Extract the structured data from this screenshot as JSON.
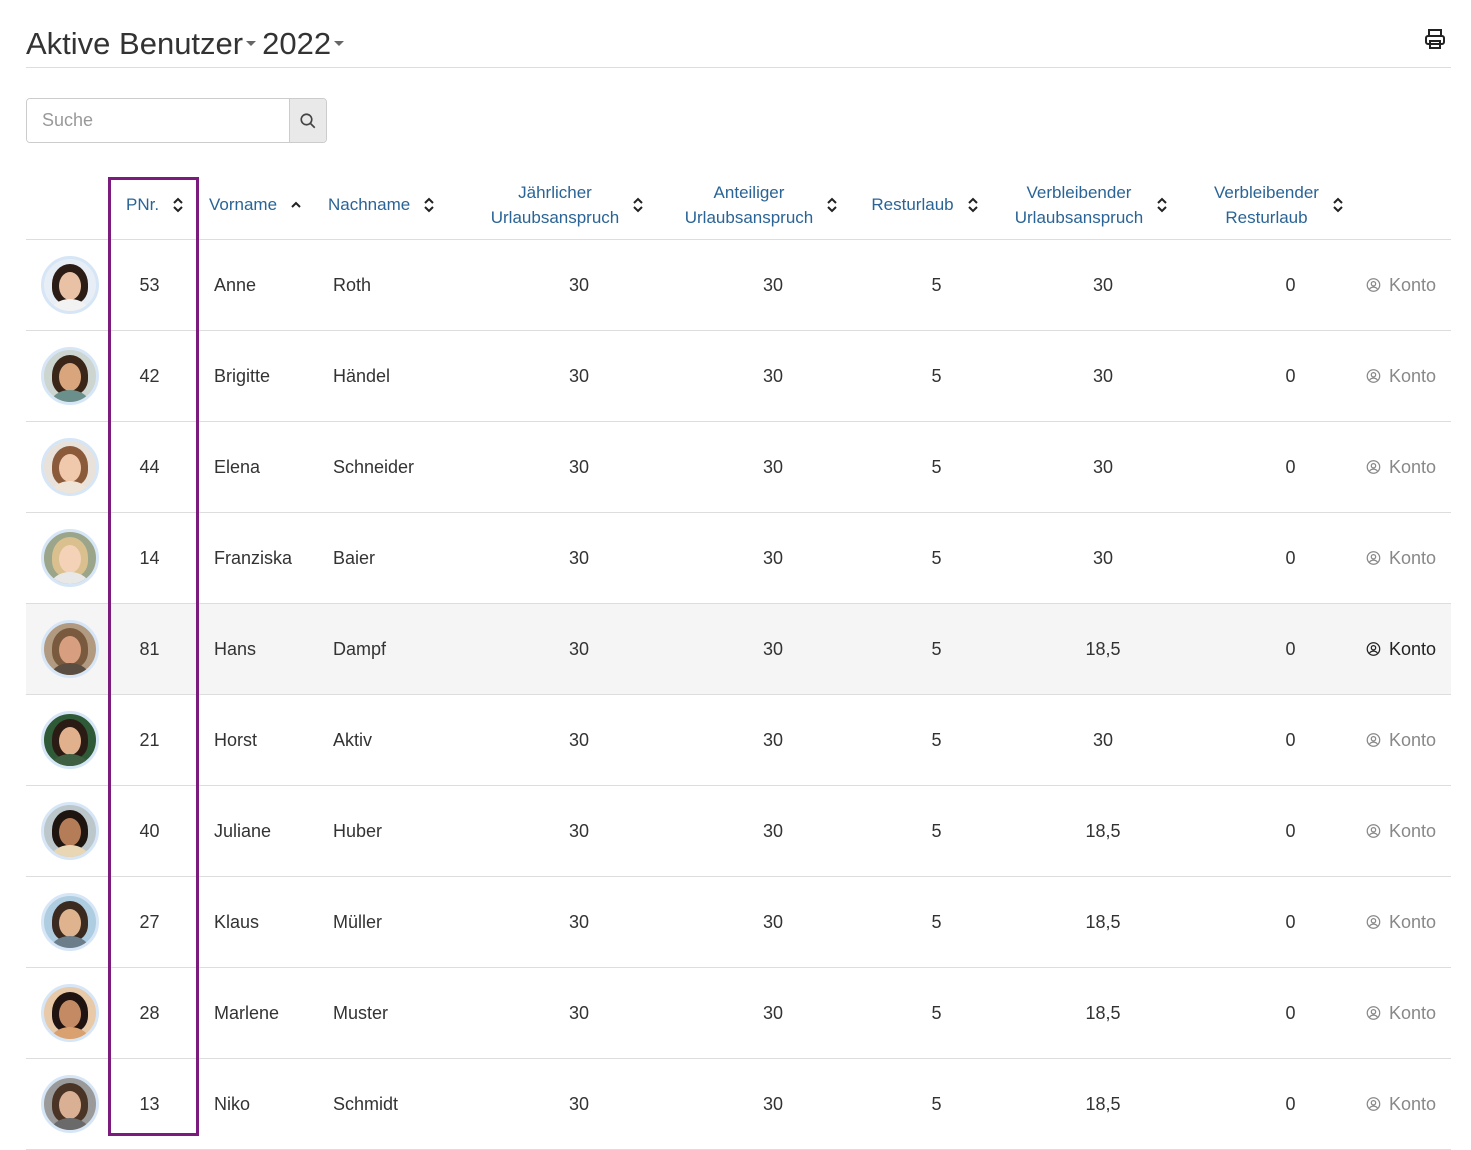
{
  "header": {
    "title_main": "Aktive Benutzer",
    "title_year": "2022",
    "print_icon": "printer-icon"
  },
  "search": {
    "placeholder": "Suche",
    "value": "",
    "icon": "search-icon"
  },
  "table": {
    "columns": [
      {
        "key": "pnr",
        "label": "PNr.",
        "sort": "both"
      },
      {
        "key": "vorname",
        "label": "Vorname",
        "sort": "asc"
      },
      {
        "key": "nachname",
        "label": "Nachname",
        "sort": "both"
      },
      {
        "key": "jaehrlich",
        "label_line1": "Jährlicher",
        "label_line2": "Urlaubsanspruch",
        "sort": "both"
      },
      {
        "key": "anteilig",
        "label_line1": "Anteiliger",
        "label_line2": "Urlaubsanspruch",
        "sort": "both"
      },
      {
        "key": "resturlaub",
        "label": "Resturlaub",
        "sort": "both"
      },
      {
        "key": "verbl_anspruch",
        "label_line1": "Verbleibender",
        "label_line2": "Urlaubsanspruch",
        "sort": "both"
      },
      {
        "key": "verbl_rest",
        "label_line1": "Verbleibender",
        "label_line2": "Resturlaub",
        "sort": "both"
      }
    ],
    "action_label": "Konto",
    "action_icon": "user-circle-icon",
    "rows": [
      {
        "pnr": "53",
        "vorname": "Anne",
        "nachname": "Roth",
        "jaehrlich": "30",
        "anteilig": "30",
        "resturlaub": "5",
        "verbl_anspruch": "30",
        "verbl_rest": "0",
        "konto": "Konto"
      },
      {
        "pnr": "42",
        "vorname": "Brigitte",
        "nachname": "Händel",
        "jaehrlich": "30",
        "anteilig": "30",
        "resturlaub": "5",
        "verbl_anspruch": "30",
        "verbl_rest": "0",
        "konto": "Konto"
      },
      {
        "pnr": "44",
        "vorname": "Elena",
        "nachname": "Schneider",
        "jaehrlich": "30",
        "anteilig": "30",
        "resturlaub": "5",
        "verbl_anspruch": "30",
        "verbl_rest": "0",
        "konto": "Konto"
      },
      {
        "pnr": "14",
        "vorname": "Franziska",
        "nachname": "Baier",
        "jaehrlich": "30",
        "anteilig": "30",
        "resturlaub": "5",
        "verbl_anspruch": "30",
        "verbl_rest": "0",
        "konto": "Konto"
      },
      {
        "pnr": "81",
        "vorname": "Hans",
        "nachname": "Dampf",
        "jaehrlich": "30",
        "anteilig": "30",
        "resturlaub": "5",
        "verbl_anspruch": "18,5",
        "verbl_rest": "0",
        "konto": "Konto"
      },
      {
        "pnr": "21",
        "vorname": "Horst",
        "nachname": "Aktiv",
        "jaehrlich": "30",
        "anteilig": "30",
        "resturlaub": "5",
        "verbl_anspruch": "30",
        "verbl_rest": "0",
        "konto": "Konto"
      },
      {
        "pnr": "40",
        "vorname": "Juliane",
        "nachname": "Huber",
        "jaehrlich": "30",
        "anteilig": "30",
        "resturlaub": "5",
        "verbl_anspruch": "18,5",
        "verbl_rest": "0",
        "konto": "Konto"
      },
      {
        "pnr": "27",
        "vorname": "Klaus",
        "nachname": "Müller",
        "jaehrlich": "30",
        "anteilig": "30",
        "resturlaub": "5",
        "verbl_anspruch": "18,5",
        "verbl_rest": "0",
        "konto": "Konto"
      },
      {
        "pnr": "28",
        "vorname": "Marlene",
        "nachname": "Muster",
        "jaehrlich": "30",
        "anteilig": "30",
        "resturlaub": "5",
        "verbl_anspruch": "18,5",
        "verbl_rest": "0",
        "konto": "Konto"
      },
      {
        "pnr": "13",
        "vorname": "Niko",
        "nachname": "Schmidt",
        "jaehrlich": "30",
        "anteilig": "30",
        "resturlaub": "5",
        "verbl_anspruch": "18,5",
        "verbl_rest": "0",
        "konto": "Konto"
      }
    ],
    "hovered_row_index": 4
  },
  "colors": {
    "header_link": "#2a6496",
    "highlight_box": "#7b1b7e",
    "hover_row": "#f5f5f5",
    "konto_inactive": "#888888",
    "konto_active": "#222222"
  },
  "avatars": [
    {
      "hair": "#2b1d16",
      "skin": "#e9c2a6",
      "shirt": "#f2f2f2",
      "bg": "#e7eef6"
    },
    {
      "hair": "#3a2618",
      "skin": "#d9a57d",
      "shirt": "#6b8f8a",
      "bg": "#cdd5d0"
    },
    {
      "hair": "#8a5a3a",
      "skin": "#f0c9ad",
      "shirt": "#efe4d8",
      "bg": "#e9e2da"
    },
    {
      "hair": "#d9c08e",
      "skin": "#f3d2b7",
      "shirt": "#e8e8e8",
      "bg": "#9aa58a"
    },
    {
      "hair": "#7a5a3e",
      "skin": "#d79f7f",
      "shirt": "#5a4d42",
      "bg": "#b19a80"
    },
    {
      "hair": "#2a1c15",
      "skin": "#e1b08c",
      "shirt": "#3f5f42",
      "bg": "#2f5a37"
    },
    {
      "hair": "#1e1410",
      "skin": "#b57c58",
      "shirt": "#e8d6b4",
      "bg": "#bcc7cc"
    },
    {
      "hair": "#3a2a20",
      "skin": "#e0b38f",
      "shirt": "#6c7e8a",
      "bg": "#aecde0"
    },
    {
      "hair": "#1f1411",
      "skin": "#c48a63",
      "shirt": "#d9a070",
      "bg": "#e8c9a8"
    },
    {
      "hair": "#4a3426",
      "skin": "#d9b093",
      "shirt": "#6a6a6a",
      "bg": "#9a9a9a"
    }
  ]
}
